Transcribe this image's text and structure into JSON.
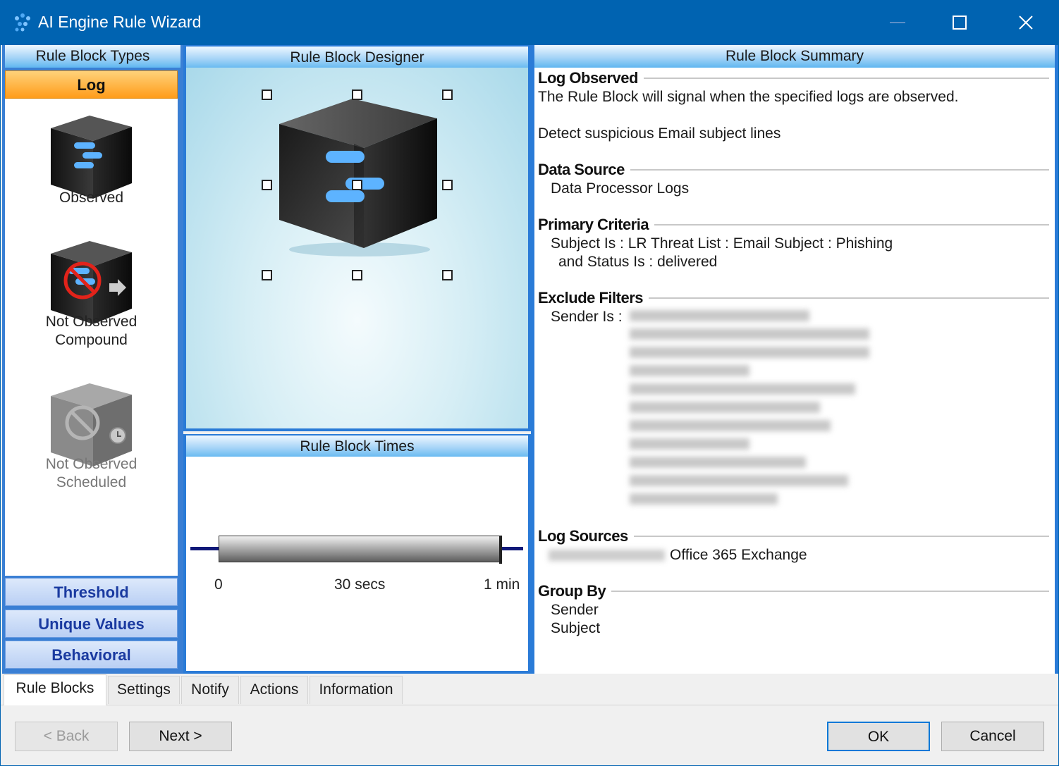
{
  "window": {
    "title": "AI Engine Rule Wizard",
    "accent": "#0063b1",
    "app_icon": "dots-logo-icon"
  },
  "rule_block_types": {
    "header": "Rule Block Types",
    "active_tab": "Log",
    "items": [
      {
        "label": "Observed",
        "icon": "cube-observed-icon",
        "enabled": true
      },
      {
        "label_line1": "Not Observed",
        "label_line2": "Compound",
        "icon": "cube-not-observed-icon",
        "enabled": true
      },
      {
        "label_line1": "Not Observed",
        "label_line2": "Scheduled",
        "icon": "cube-scheduled-icon",
        "enabled": false
      }
    ],
    "tabs": [
      "Threshold",
      "Unique Values",
      "Behavioral"
    ]
  },
  "designer": {
    "header": "Rule Block Designer"
  },
  "times": {
    "header": "Rule Block Times",
    "labels": [
      "0",
      "30 secs",
      "1 min"
    ]
  },
  "summary": {
    "header": "Rule Block Summary",
    "log_observed": {
      "title": "Log Observed",
      "desc": "The Rule Block will signal when the specified logs are observed.",
      "name": "Detect suspicious Email subject lines"
    },
    "data_source": {
      "title": "Data Source",
      "value": "Data Processor Logs"
    },
    "primary_criteria": {
      "title": "Primary Criteria",
      "line1": "Subject Is :  LR Threat List : Email Subject : Phishing",
      "line2": "and Status Is :  delivered"
    },
    "exclude_filters": {
      "title": "Exclude Filters",
      "label": "Sender Is :"
    },
    "log_sources": {
      "title": "Log Sources",
      "value": "Office 365 Exchange"
    },
    "group_by": {
      "title": "Group By",
      "items": [
        "Sender",
        "Subject"
      ]
    }
  },
  "bottom_tabs": [
    "Rule Blocks",
    "Settings",
    "Notify",
    "Actions",
    "Information"
  ],
  "buttons": {
    "back": "< Back",
    "next": "Next >",
    "ok": "OK",
    "cancel": "Cancel"
  }
}
